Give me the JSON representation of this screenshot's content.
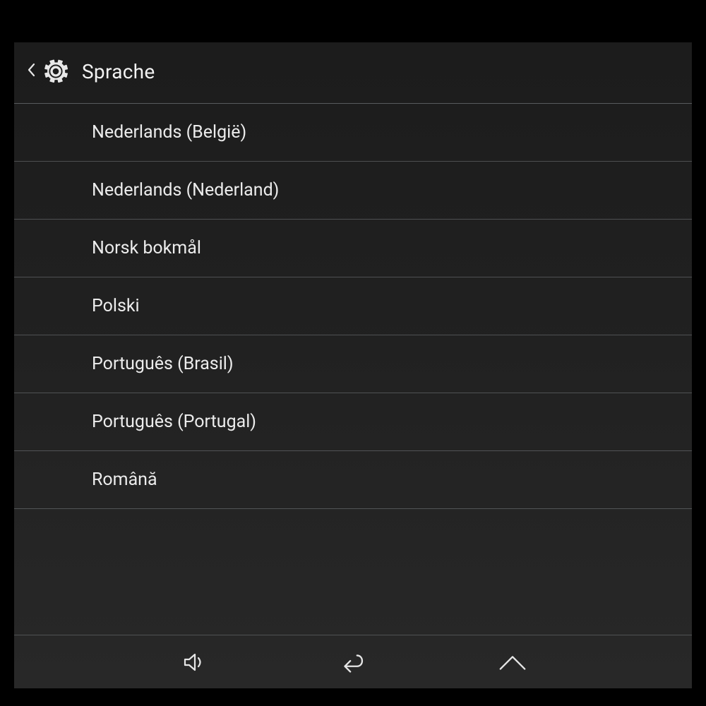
{
  "header": {
    "title": "Sprache"
  },
  "languages": [
    {
      "label": "Nederlands (België)"
    },
    {
      "label": "Nederlands (Nederland)"
    },
    {
      "label": "Norsk bokmål"
    },
    {
      "label": "Polski"
    },
    {
      "label": "Português (Brasil)"
    },
    {
      "label": "Português (Portugal)"
    },
    {
      "label": "Română"
    }
  ],
  "navbar": {
    "volume": "volume",
    "back": "back",
    "home": "home"
  }
}
